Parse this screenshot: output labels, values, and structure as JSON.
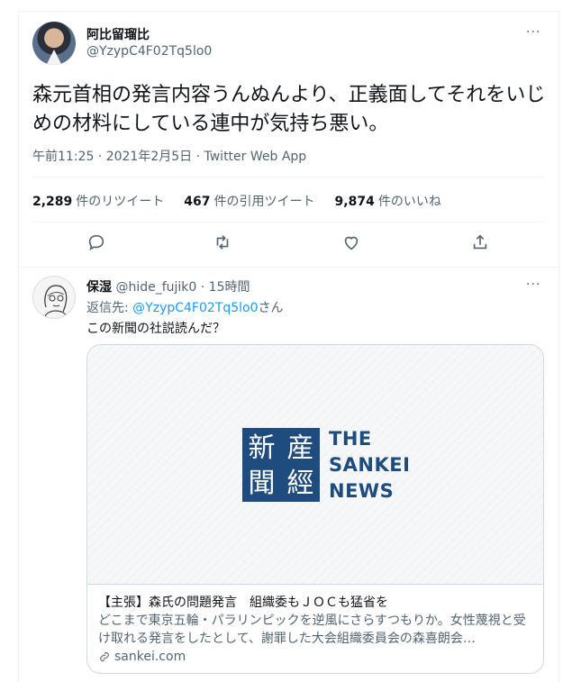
{
  "tweet": {
    "display_name": "阿比留瑠比",
    "handle": "@YzypC4F02Tq5lo0",
    "more": "···",
    "text": "森元首相の発言内容うんぬんより、正義面してそれをいじめの材料にしている連中が気持ち悪い。",
    "meta": "午前11:25 · 2021年2月5日 · Twitter Web App"
  },
  "stats": [
    {
      "count": "2,289",
      "label": "件のリツイート"
    },
    {
      "count": "467",
      "label": "件の引用ツイート"
    },
    {
      "count": "9,874",
      "label": "件のいいね"
    }
  ],
  "actions": [
    {
      "name": "reply-icon"
    },
    {
      "name": "retweet-icon"
    },
    {
      "name": "like-icon"
    },
    {
      "name": "share-icon"
    }
  ],
  "reply": {
    "display_name": "保湿",
    "handle": "@hide_fujik0",
    "time": "15時間",
    "more": "···",
    "reply_to_prefix": "返信先: ",
    "reply_to_handle": "@YzypC4F02Tq5lo0",
    "reply_to_suffix": "さん",
    "text": "この新聞の社説読んだ？",
    "card": {
      "logo_chars": [
        "新",
        "産",
        "聞",
        "經"
      ],
      "logo_words": [
        "THE",
        "SANKEI",
        "NEWS"
      ],
      "title": "【主張】森氏の問題発言　組織委もＪＯＣも猛省を",
      "description": "どこまで東京五輪・パラリンピックを逆風にさらすつもりか。女性蔑視と受け取れる発言をしたとして、謝罪した大会組織委員会の森喜朗会…",
      "domain": "sankei.com"
    }
  },
  "colors": {
    "accent": "#1d9bf0",
    "muted": "#536471",
    "brand": "#1f4c7e"
  }
}
